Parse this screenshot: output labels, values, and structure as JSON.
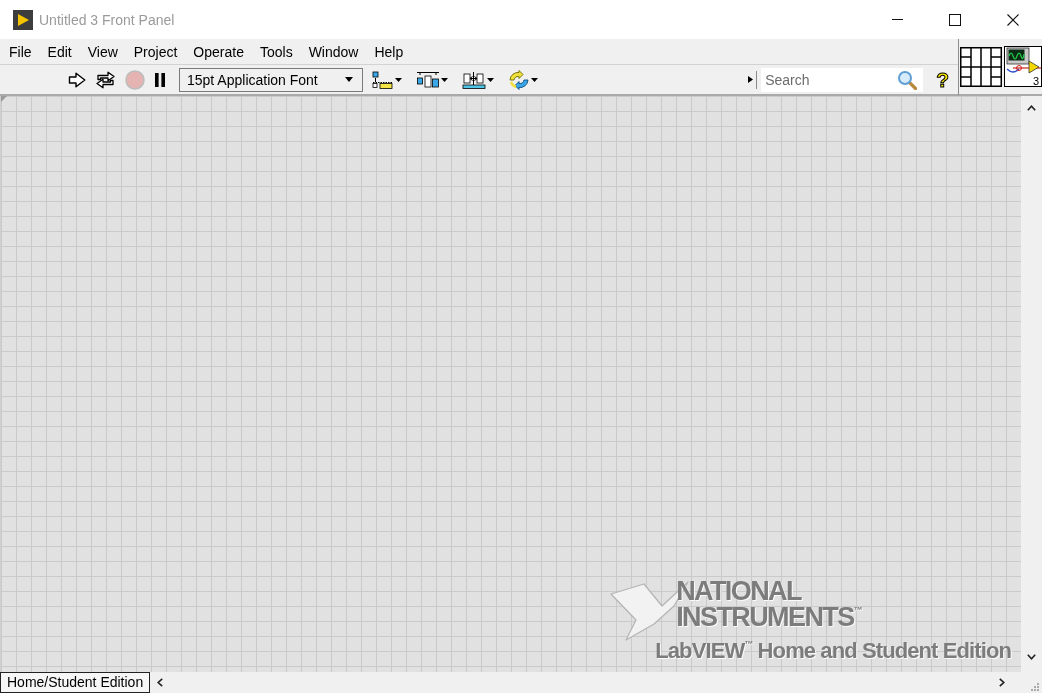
{
  "window": {
    "title": "Untitled 3 Front Panel"
  },
  "menu": [
    "File",
    "Edit",
    "View",
    "Project",
    "Operate",
    "Tools",
    "Window",
    "Help"
  ],
  "toolbar": {
    "font": "15pt Application Font",
    "search": {
      "placeholder": "Search"
    },
    "help": "?"
  },
  "vi_icon": {
    "number": "3"
  },
  "canvas": {
    "watermark": [
      "NATIONAL",
      "INSTRUMENTS$^{™}$",
      "LabVIEW$^{™}$ Home and Student Edition"
    ]
  },
  "status_bar": {
    "edition": "Home/Student Edition"
  }
}
